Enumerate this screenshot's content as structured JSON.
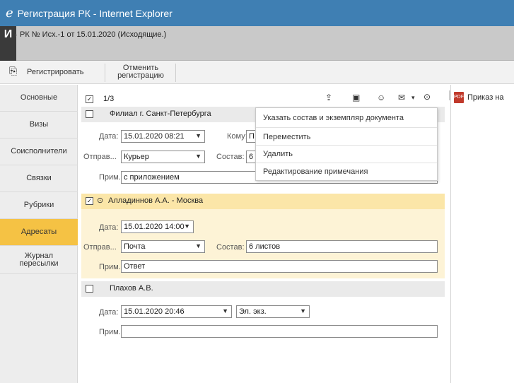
{
  "window": {
    "title": "Регистрация РК - Internet Explorer",
    "logo": "e"
  },
  "header": {
    "brand": "И",
    "rk_title": "РК № Исх.-1 от 15.01.2020 (Исходящие.)"
  },
  "toolbar": {
    "register_label": "Регистрировать",
    "cancel_label": "Отменить регистрацию"
  },
  "sidebar": {
    "items": [
      {
        "label": "Основные"
      },
      {
        "label": "Визы"
      },
      {
        "label": "Соисполнители"
      },
      {
        "label": "Связки"
      },
      {
        "label": "Рубрики"
      },
      {
        "label": "Адресаты",
        "active": true
      },
      {
        "label": "Журнал пересылки"
      }
    ]
  },
  "list": {
    "counter": "1/3",
    "icons": [
      "upload-icon",
      "card-add-icon",
      "person-add-icon",
      "mail-check-icon",
      "more-icon"
    ]
  },
  "addressees": [
    {
      "name": "Филиал г. Санкт-Петербурга",
      "checked": false,
      "date_label": "Дата:",
      "date_value": "15.01.2020 08:21",
      "to_label": "Кому:",
      "to_value": "П",
      "send_label": "Отправ...",
      "send_value": "Курьер",
      "composition_label": "Состав:",
      "composition_value": "6",
      "note_label": "Прим.:",
      "note_value": "с приложением"
    },
    {
      "name": "Алладиннов А.А. - Москва",
      "checked": true,
      "date_label": "Дата:",
      "date_value": "15.01.2020 14:00",
      "send_label": "Отправ...",
      "send_value": "Почта",
      "composition_label": "Состав:",
      "composition_value": "6 листов",
      "note_label": "Прим.:",
      "note_value": "Ответ"
    },
    {
      "name": "Плахов А.В.",
      "checked": false,
      "date_label": "Дата:",
      "date_value": "15.01.2020 20:46",
      "type_value": "Эл. экз.",
      "note_label": "Прим.:",
      "note_value": ""
    }
  ],
  "context_menu": {
    "items": [
      "Указать состав и экземпляр документа",
      "Переместить",
      "Удалить",
      "Редактирование примечания"
    ]
  },
  "right_pane": {
    "document": "Приказ на"
  },
  "colors": {
    "titlebar": "#3f7fb3",
    "active_tab": "#f5c244",
    "selected_row": "#fbe6a8"
  }
}
